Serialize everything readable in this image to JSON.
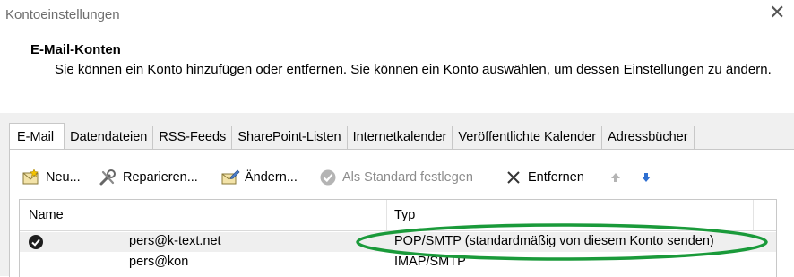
{
  "window": {
    "title": "Kontoeinstellungen",
    "close_icon": "close-icon"
  },
  "header": {
    "title": "E-Mail-Konten",
    "description": "Sie können ein Konto hinzufügen oder entfernen. Sie können ein Konto auswählen, um dessen Einstellungen zu ändern."
  },
  "tabs": [
    {
      "label": "E-Mail",
      "active": true
    },
    {
      "label": "Datendateien",
      "active": false
    },
    {
      "label": "RSS-Feeds",
      "active": false
    },
    {
      "label": "SharePoint-Listen",
      "active": false
    },
    {
      "label": "Internetkalender",
      "active": false
    },
    {
      "label": "Veröffentlichte Kalender",
      "active": false
    },
    {
      "label": "Adressbücher",
      "active": false
    }
  ],
  "toolbar": {
    "new_label": "Neu...",
    "repair_label": "Reparieren...",
    "change_label": "Ändern...",
    "set_default_label": "Als Standard festlegen",
    "remove_label": "Entfernen",
    "move_up_icon": "arrow-up-icon",
    "move_down_icon": "arrow-down-icon"
  },
  "accounts_list": {
    "columns": {
      "name": "Name",
      "type": "Typ"
    },
    "rows": [
      {
        "name": "pers@k-text.net",
        "type": "POP/SMTP (standardmäßig von diesem Konto senden)",
        "default": true
      },
      {
        "name": "pers@kon",
        "type": "IMAP/SMTP",
        "default": false
      }
    ]
  },
  "colors": {
    "highlight_ellipse": "#1a9a3a",
    "arrow_down": "#2e6fd1",
    "disabled_text": "#8c8c8c"
  }
}
